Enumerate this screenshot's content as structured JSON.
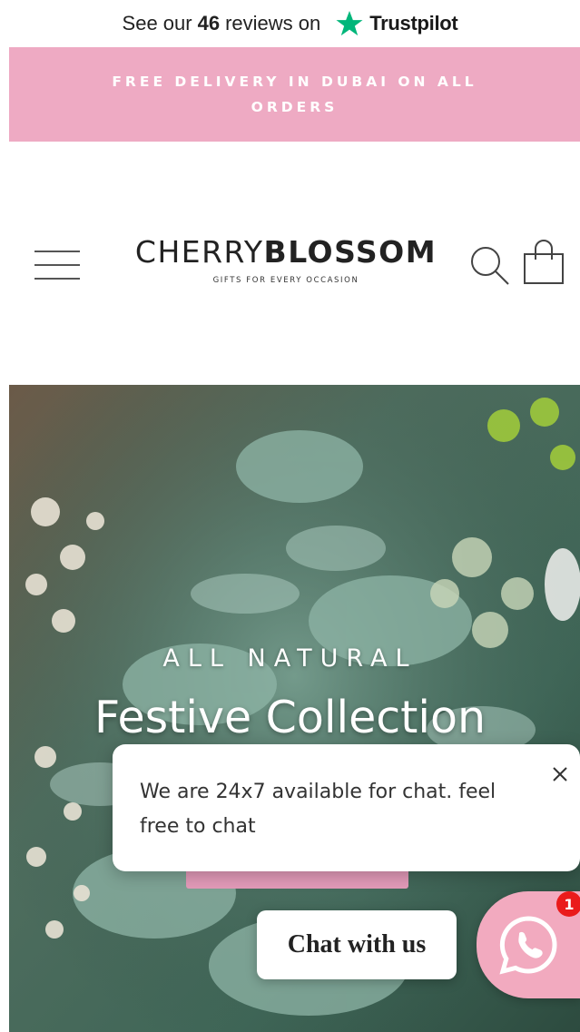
{
  "trustpilot": {
    "prefix": "See our",
    "count": "46",
    "suffix": "reviews on",
    "brand": "Trustpilot",
    "star_color": "#00b67a"
  },
  "announcement": {
    "text": "FREE DELIVERY IN DUBAI ON ALL ORDERS",
    "background": "#eeaac3"
  },
  "header": {
    "logo_thin": "CHERRY",
    "logo_bold": "BLOSSOM",
    "tagline": "GIFTS FOR EVERY OCCASION",
    "menu_icon": "hamburger-menu-icon",
    "search_icon": "search-icon",
    "cart_icon": "shopping-bag-icon"
  },
  "hero": {
    "subtitle": "ALL NATURAL",
    "title": "Festive Collection",
    "cta_color": "#e29ab8"
  },
  "chat": {
    "popup_text": "We are 24x7 available for chat. feel free to chat",
    "close_icon": "close-icon",
    "button_label": "Chat with us",
    "whatsapp_icon": "whatsapp-icon",
    "badge_count": "1",
    "whatsapp_bg": "#f2aabf",
    "badge_color": "#ea1b1b"
  }
}
